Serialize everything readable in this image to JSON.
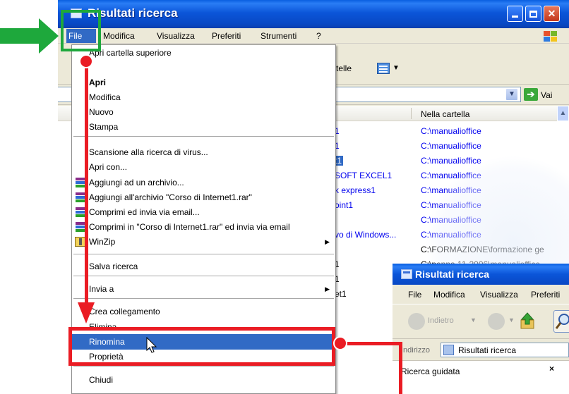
{
  "window": {
    "title": "Risultati ricerca",
    "menu": [
      "File",
      "Modifica",
      "Visualizza",
      "Preferiti",
      "Strumenti",
      "?"
    ],
    "toolbar_partial_label": "rtelle",
    "go_label": "Vai",
    "column_header": "Nella cartella",
    "rows": [
      {
        "name": "1",
        "folder": "C:\\manualioffice"
      },
      {
        "name": "1",
        "folder": "C:\\manualioffice"
      },
      {
        "name": "t1",
        "folder": "C:\\manualioffice",
        "selected": true
      },
      {
        "name": "SOFT EXCEL1",
        "folder": "C:\\manualioffice"
      },
      {
        "name": "k express1",
        "folder": "C:\\manualioffice"
      },
      {
        "name": "oint1",
        "folder": "C:\\manualioffice"
      },
      {
        "name": "",
        "folder": "C:\\manualioffice"
      },
      {
        "name": "vo di Windows...",
        "folder": "C:\\manualioffice"
      },
      {
        "name": "",
        "folder": "C:\\FORMAZIONE\\formazione ge"
      },
      {
        "name": "1",
        "folder": "C:\\penna 11-2006\\manualioffice"
      },
      {
        "name": "1",
        "folder": ""
      },
      {
        "name": "et1",
        "folder": ""
      }
    ]
  },
  "file_menu": {
    "items": [
      {
        "label": "Apri cartella superiore",
        "style": "normal"
      },
      {
        "label": "Apri",
        "style": "bold"
      },
      {
        "label": "Modifica",
        "style": "normal"
      },
      {
        "label": "Nuovo",
        "style": "normal"
      },
      {
        "label": "Stampa",
        "style": "normal"
      },
      {
        "label": "Scansione alla ricerca di virus...",
        "style": "normal"
      },
      {
        "label": "Apri con...",
        "style": "normal"
      },
      {
        "label": "Aggiungi ad un archivio...",
        "style": "normal",
        "icon": "winrar-icon"
      },
      {
        "label": "Aggiungi all'archivio \"Corso di Internet1.rar\"",
        "style": "normal",
        "icon": "winrar-icon"
      },
      {
        "label": "Comprimi ed invia via email...",
        "style": "normal",
        "icon": "winrar-icon"
      },
      {
        "label": "Comprimi in \"Corso di Internet1.rar\" ed invia via email",
        "style": "normal",
        "icon": "winrar-icon"
      },
      {
        "label": "WinZip",
        "style": "normal",
        "icon": "winzip-icon",
        "submenu": true
      },
      {
        "label": "Salva ricerca",
        "style": "normal"
      },
      {
        "label": "Invia a",
        "style": "normal",
        "submenu": true
      },
      {
        "label": "Crea collegamento",
        "style": "normal"
      },
      {
        "label": "Elimina",
        "style": "normal"
      },
      {
        "label": "Rinomina",
        "style": "selected"
      },
      {
        "label": "Proprietà",
        "style": "normal"
      },
      {
        "label": "Chiudi",
        "style": "normal"
      }
    ]
  },
  "window2": {
    "title": "Risultati ricerca",
    "menu": [
      "File",
      "Modifica",
      "Visualizza",
      "Preferiti"
    ],
    "back_label": "Indietro",
    "address_label": "Indirizzo",
    "address_value": "Risultati ricerca",
    "pane_title": "Ricerca guidata",
    "pane_close": "×"
  },
  "colors": {
    "xp_blue": "#0b55d9",
    "selection": "#316ac5",
    "annotation_green": "#1ea83c",
    "annotation_red": "#ea1c24",
    "link_blue": "#0000ee"
  }
}
